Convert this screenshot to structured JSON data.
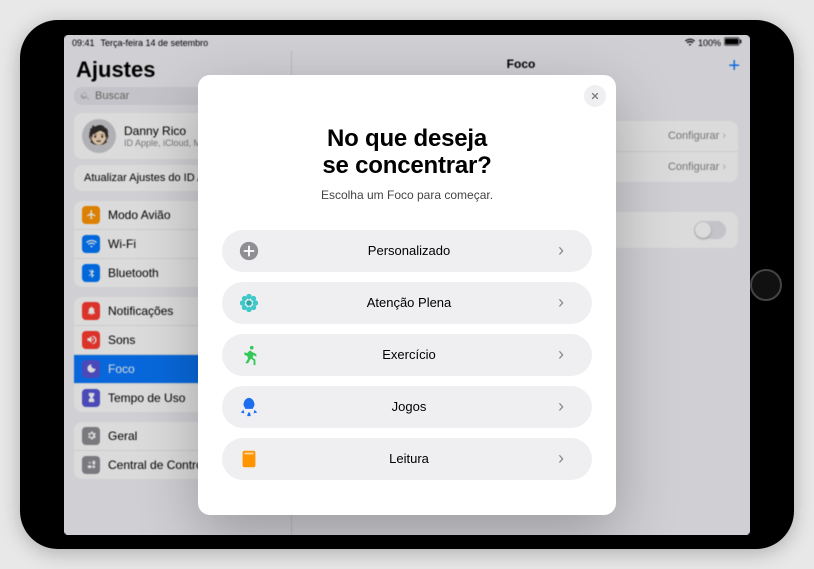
{
  "status": {
    "time": "09:41",
    "date": "Terça-feira 14 de setembro",
    "battery": "100%"
  },
  "sidebar": {
    "title": "Ajustes",
    "search_placeholder": "Buscar",
    "profile": {
      "name": "Danny Rico",
      "sub": "ID Apple, iCloud, Mídia"
    },
    "banner": "Atualizar Ajustes do ID Apple",
    "g1": [
      {
        "label": "Modo Avião",
        "icon": "airplane",
        "color": "#ff9500"
      },
      {
        "label": "Wi-Fi",
        "icon": "wifi",
        "color": "#007aff"
      },
      {
        "label": "Bluetooth",
        "icon": "bt",
        "color": "#007aff"
      }
    ],
    "g2": [
      {
        "label": "Notificações",
        "icon": "bell",
        "color": "#ff3b30"
      },
      {
        "label": "Sons",
        "icon": "sound",
        "color": "#ff3b30"
      },
      {
        "label": "Foco",
        "icon": "moon",
        "color": "#5856d6",
        "selected": true
      },
      {
        "label": "Tempo de Uso",
        "icon": "timer",
        "color": "#5856d6"
      }
    ],
    "g3": [
      {
        "label": "Geral",
        "icon": "gear",
        "color": "#8e8e93"
      },
      {
        "label": "Central de Controle",
        "icon": "cc",
        "color": "#8e8e93"
      }
    ]
  },
  "detail": {
    "title": "Foco",
    "rows_a": [
      {
        "label": "",
        "action": "Configurar"
      },
      {
        "label": "",
        "action": "Configurar"
      }
    ]
  },
  "modal": {
    "heading_line1": "No que deseja",
    "heading_line2": "se concentrar?",
    "sub": "Escolha um Foco para começar.",
    "options": [
      {
        "label": "Personalizado",
        "icon": "plus",
        "color": "#8e8e93"
      },
      {
        "label": "Atenção Plena",
        "icon": "mind",
        "color": "#3ec8c8"
      },
      {
        "label": "Exercício",
        "icon": "run",
        "color": "#34c759"
      },
      {
        "label": "Jogos",
        "icon": "rocket",
        "color": "#1e6ef0"
      },
      {
        "label": "Leitura",
        "icon": "book",
        "color": "#ff9500"
      }
    ]
  }
}
